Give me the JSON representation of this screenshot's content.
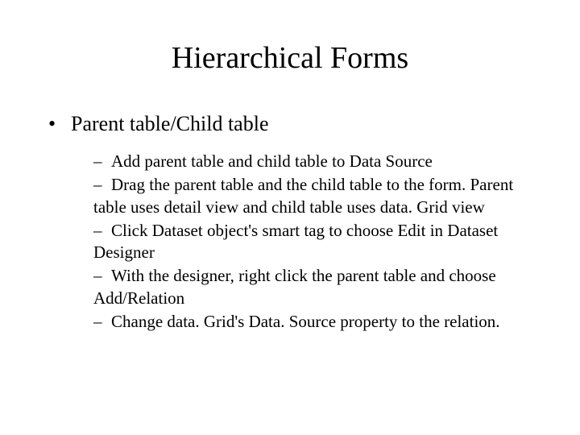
{
  "title": "Hierarchical Forms",
  "bullet1": {
    "marker": "•",
    "text": "Parent table/Child table"
  },
  "subitems": [
    {
      "marker": "–",
      "text": "Add parent table and child table to Data Source"
    },
    {
      "marker": "–",
      "text": "Drag the parent table and the child table to the form. Parent table uses detail view and child table uses data. Grid view"
    },
    {
      "marker": "–",
      "text": "Click Dataset object's smart tag to choose Edit in Dataset Designer"
    },
    {
      "marker": "–",
      "text": "With the designer, right click the parent table and choose Add/Relation"
    },
    {
      "marker": "–",
      "text": "Change data. Grid's Data. Source property to the relation."
    }
  ]
}
